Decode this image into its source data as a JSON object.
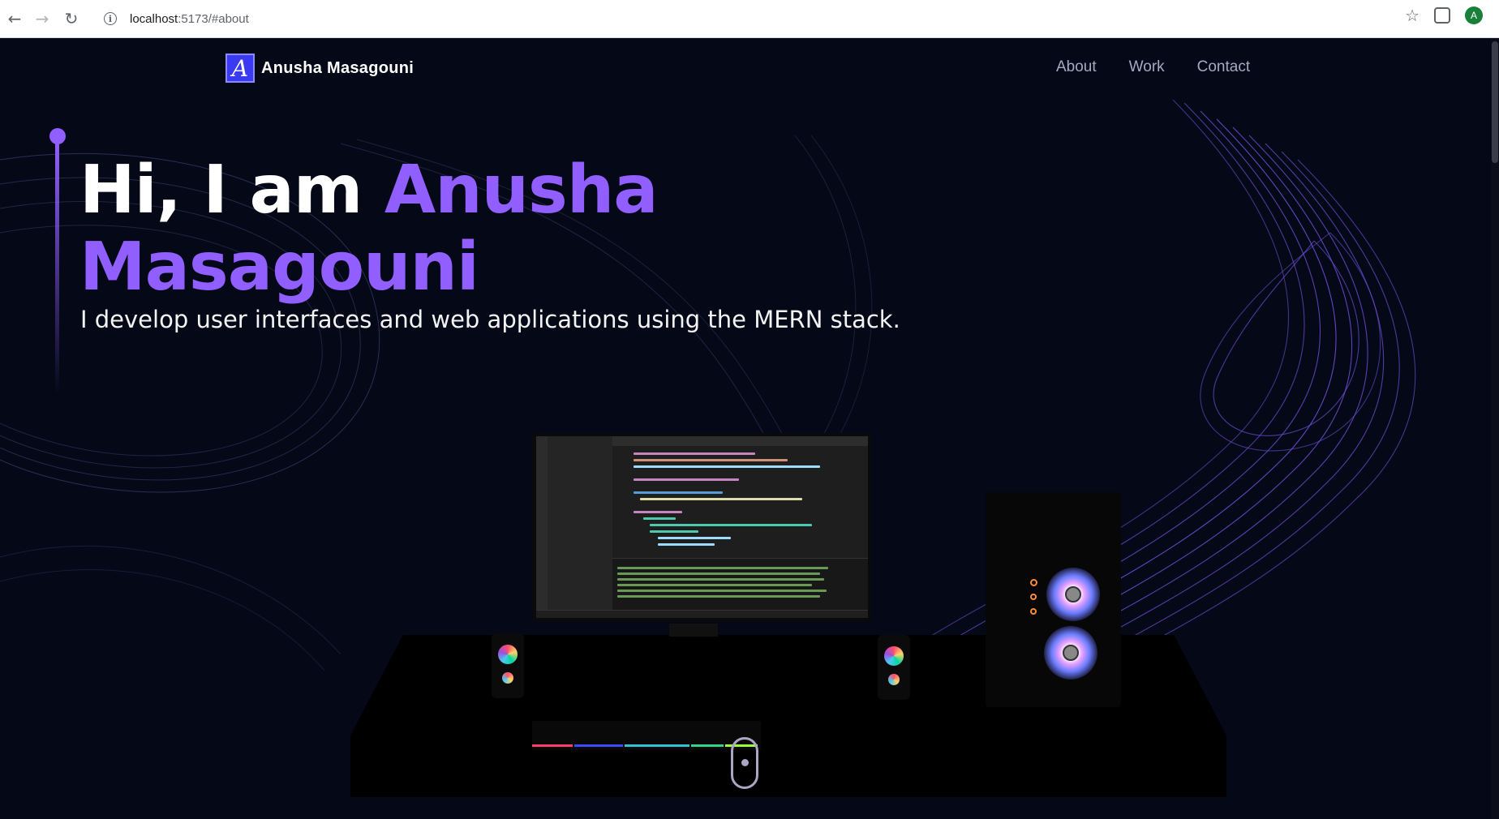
{
  "browser": {
    "url_host": "localhost",
    "url_rest": ":5173/#about",
    "avatar_letter": "A"
  },
  "navbar": {
    "logo_letter": "A",
    "brand": "Anusha Masagouni",
    "links": [
      "About",
      "Work",
      "Contact"
    ]
  },
  "hero": {
    "greeting": "Hi, I am ",
    "name_first": "Anusha",
    "name_last": "Masagouni",
    "subtitle": "I develop user interfaces and web applications using the MERN stack."
  },
  "colors": {
    "background": "#050816",
    "accent": "#915eff",
    "nav_text": "#aaa6c3"
  }
}
